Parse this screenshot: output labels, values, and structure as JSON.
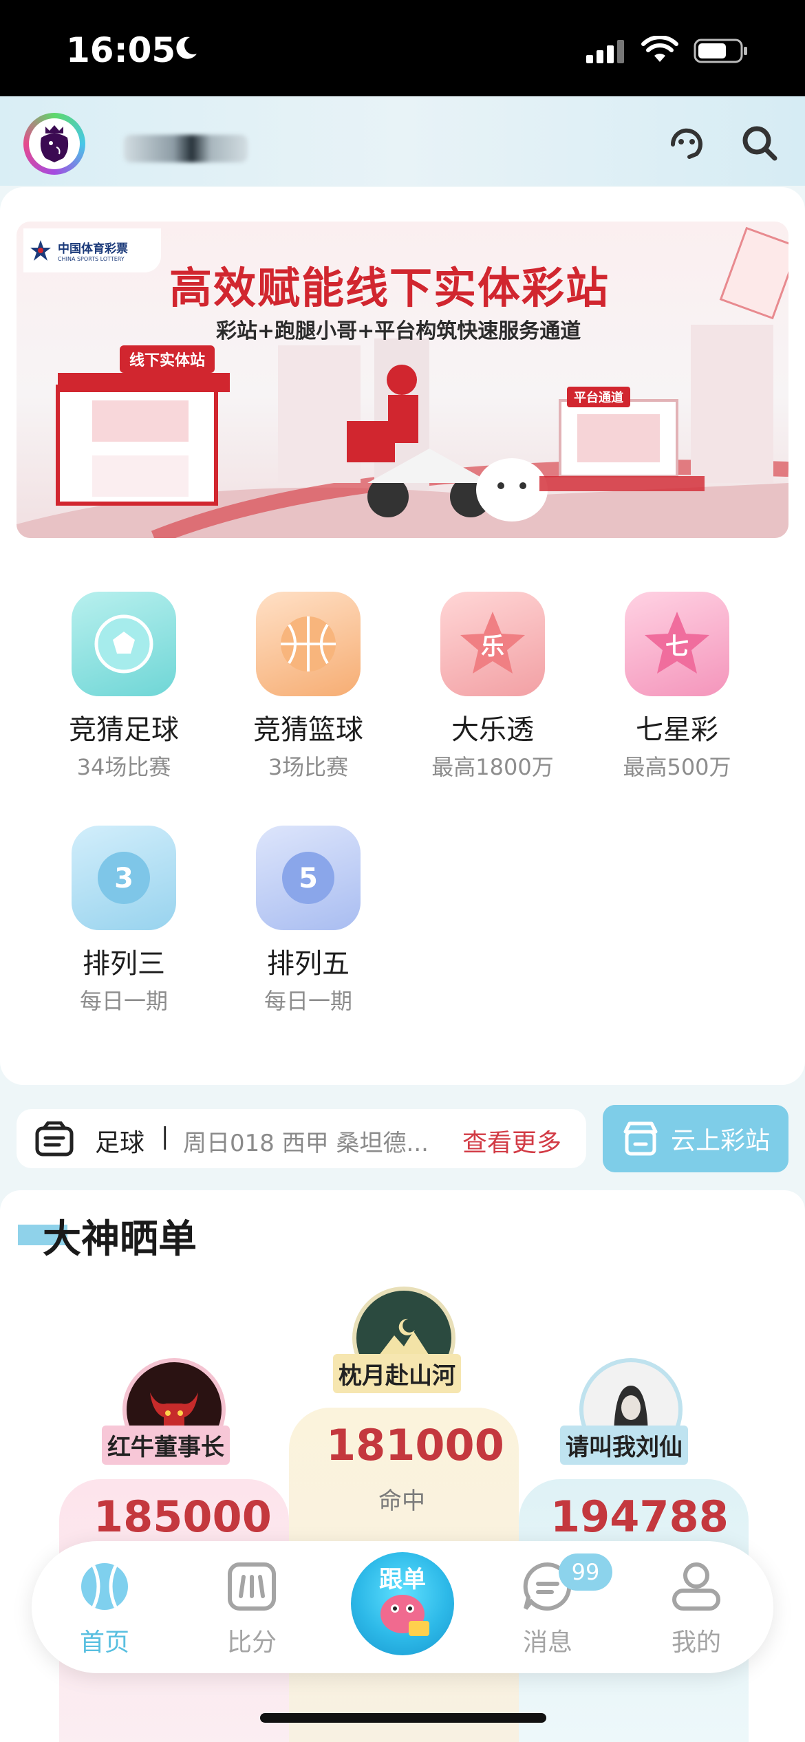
{
  "status_bar": {
    "time": "16:05"
  },
  "header": {
    "username": ""
  },
  "banner": {
    "logo_cn": "中国体育彩票",
    "logo_en": "CHINA SPORTS LOTTERY",
    "title": "高效赋能线下实体彩站",
    "subtitle": "彩站+跑腿小哥+平台构筑快速服务通道",
    "kiosk_label": "线下实体站",
    "platform_label": "平台通道"
  },
  "lotteries": [
    {
      "name": "竞猜足球",
      "sub": "34场比赛",
      "icon": "soccer-ball-icon",
      "color": "#6fd6d6"
    },
    {
      "name": "竞猜篮球",
      "sub": "3场比赛",
      "icon": "basketball-icon",
      "color": "#f6ad73"
    },
    {
      "name": "大乐透",
      "sub": "最高1800万",
      "icon": "star-le-icon",
      "color": "#f07f83"
    },
    {
      "name": "七星彩",
      "sub": "最高500万",
      "icon": "star-qi-icon",
      "color": "#f06d9d"
    },
    {
      "name": "排列三",
      "sub": "每日一期",
      "icon": "pl3-ball-icon",
      "color": "#6ec3e6"
    },
    {
      "name": "排列五",
      "sub": "每日一期",
      "icon": "pl5-ball-icon",
      "color": "#7b9ee8"
    }
  ],
  "ticker": {
    "category": "足球",
    "separator": "|",
    "text": "周日018 西甲 桑坦德...",
    "more": "查看更多"
  },
  "cloud_station": {
    "label": "云上彩站"
  },
  "masters": {
    "title": "大神晒单",
    "ranks": [
      {
        "name": "红牛董事长",
        "score": "185000"
      },
      {
        "name": "枕月赴山河",
        "score": "181000",
        "hit": "命中"
      },
      {
        "name": "请叫我刘仙",
        "score": "194788"
      }
    ]
  },
  "tabbar": {
    "home": "首页",
    "score": "比分",
    "follow": "跟单",
    "messages": "消息",
    "messages_badge": "99",
    "mine": "我的"
  },
  "colors": {
    "accent": "#58bfe0",
    "red": "#d1262f",
    "score_red": "#c4383e"
  }
}
